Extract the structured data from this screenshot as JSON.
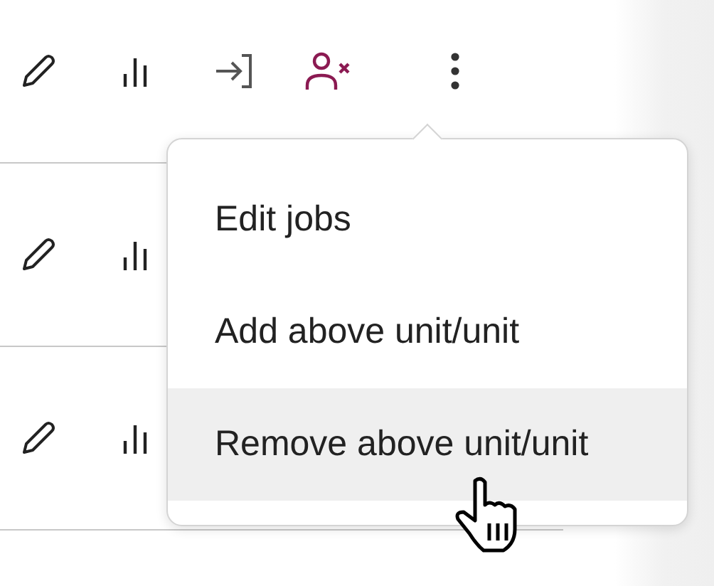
{
  "rows": [
    {
      "kind": "full"
    },
    {
      "kind": "partial"
    },
    {
      "kind": "partial"
    }
  ],
  "menu": {
    "items": [
      {
        "label": "Edit jobs",
        "hovered": false
      },
      {
        "label": "Add above unit/unit",
        "hovered": false
      },
      {
        "label": "Remove above unit/unit",
        "hovered": true
      }
    ]
  }
}
